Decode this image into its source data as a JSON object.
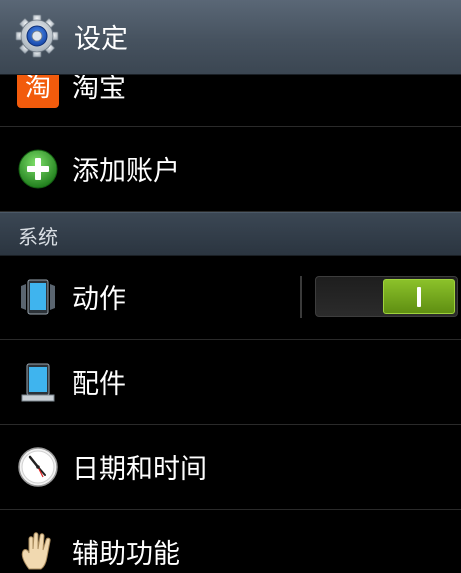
{
  "header": {
    "title": "设定",
    "icon": "gear-icon"
  },
  "rows_top": [
    {
      "label": "淘宝",
      "icon": "taobao-icon",
      "icon_text": "淘"
    },
    {
      "label": "添加账户",
      "icon": "add-circle-icon"
    }
  ],
  "section": {
    "label": "系统"
  },
  "rows_system": [
    {
      "label": "动作",
      "icon": "motion-icon",
      "toggle_on": true
    },
    {
      "label": "配件",
      "icon": "accessory-icon"
    },
    {
      "label": "日期和时间",
      "icon": "clock-icon"
    },
    {
      "label": "辅助功能",
      "icon": "hand-icon"
    }
  ],
  "colors": {
    "header_bg": "#4b5764",
    "toggle_on": "#6fa31a",
    "add_green": "#2f9b2a",
    "taobao_orange": "#f25b0c"
  }
}
